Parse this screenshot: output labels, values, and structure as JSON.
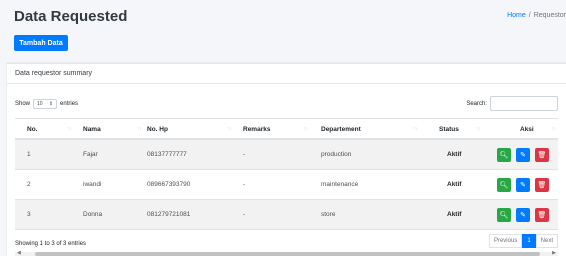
{
  "header": {
    "title": "Data Requested",
    "breadcrumb": [
      "Home",
      "Requestor"
    ]
  },
  "add_button_label": "Tambah Data",
  "card": {
    "title": "Data requestor summary",
    "show_label": "Show",
    "entries_value": "10",
    "entries_label": "entries",
    "search_label": "Search:",
    "search_value": ""
  },
  "table": {
    "columns": [
      "No.",
      "Nama",
      "No. Hp",
      "Remarks",
      "Departement",
      "Status",
      "Aksi"
    ],
    "rows": [
      {
        "no": "1",
        "nama": "Fajar",
        "hp": "08137777777",
        "remarks": "-",
        "departement": "production",
        "status": "Aktif"
      },
      {
        "no": "2",
        "nama": "iwandi",
        "hp": "089667393790",
        "remarks": "-",
        "departement": "maintenance",
        "status": "Aktif"
      },
      {
        "no": "3",
        "nama": "Donna",
        "hp": "081279721081",
        "remarks": "-",
        "departement": "store",
        "status": "Aktif"
      }
    ]
  },
  "footer": {
    "info": "Showing 1 to 3 of 3 entries",
    "previous": "Previous",
    "current_page": "1",
    "next": "Next"
  },
  "icons": {
    "view": "search-icon",
    "edit": "edit-icon",
    "delete": "trash-icon"
  },
  "colors": {
    "primary": "#007bff",
    "success": "#28a745",
    "danger": "#dc3545"
  }
}
